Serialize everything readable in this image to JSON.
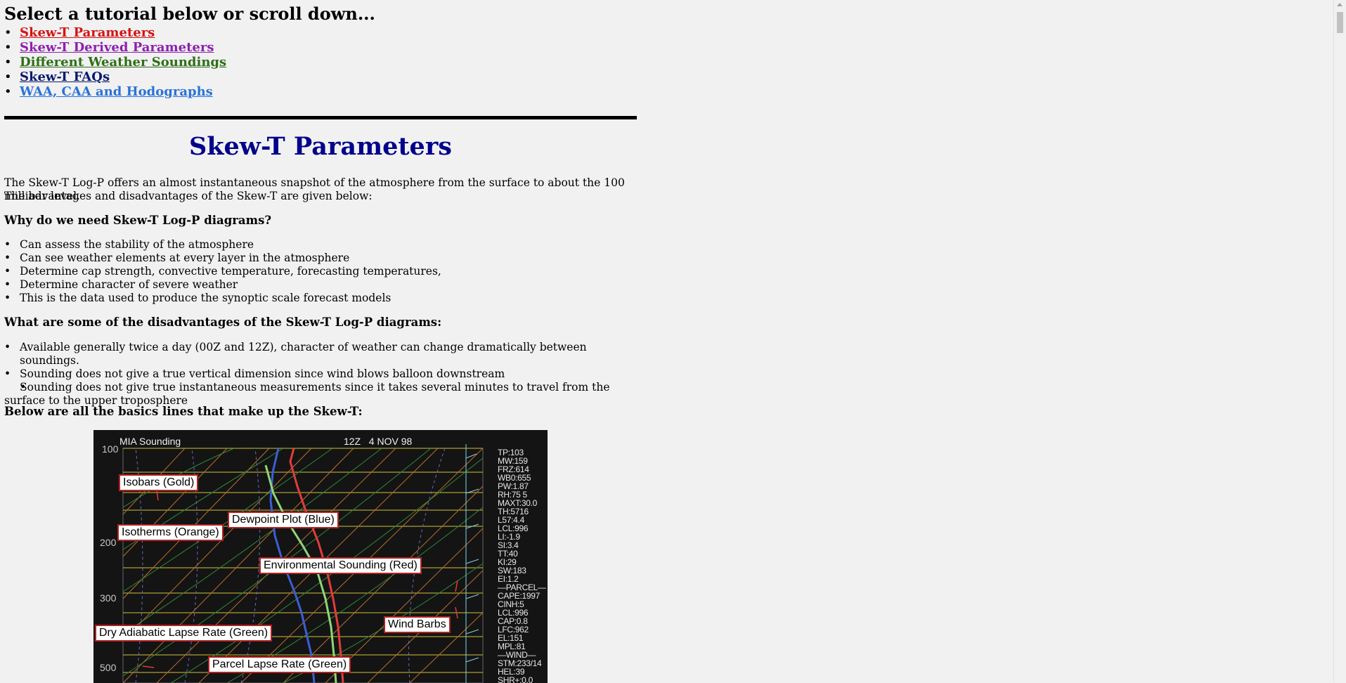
{
  "heading": "Select a tutorial below or scroll down...",
  "tutorials": [
    {
      "label": "Skew-T Parameters",
      "color": "#d41313"
    },
    {
      "label": "Skew-T Derived Parameters",
      "color": "#8e1fb0"
    },
    {
      "label": "Different Weather Soundings",
      "color": "#2e6e17"
    },
    {
      "label": "Skew-T FAQs",
      "color": "#0a1a6e"
    },
    {
      "label": "WAA, CAA and Hodographs",
      "color": "#2a73d6"
    }
  ],
  "section_title": "Skew-T Parameters",
  "intro_line1": "The Skew-T Log-P offers an almost instantaneous snapshot of the atmosphere from the surface to about the 100 millibar level.",
  "intro_line2": "The advantages and disadvantages of the Skew-T are given below:",
  "why_heading": "Why do we need Skew-T Log-P diagrams?",
  "why_items": [
    "Can assess the stability of the atmosphere",
    "Can see weather elements at every layer in the atmosphere",
    "Determine cap strength, convective temperature, forecasting temperatures,",
    "Determine character of severe weather",
    "This is the data used to produce the synoptic scale forecast models"
  ],
  "dis_heading": "What are some of the disadvantages of the Skew-T Log-P diagrams:",
  "dis_items": [
    "Available generally twice a day (00Z and 12Z), character of weather can change dramatically between soundings.",
    "Sounding does not give a true vertical dimension since wind blows balloon downstream",
    "Sounding does not give true instantaneous measurements since it takes several minutes to travel from the surface to the upper troposphere"
  ],
  "basics_heading": "Below are all the basics lines that make up the Skew-T:",
  "skewt": {
    "station": "MIA Sounding",
    "time": "12Z   4 NOV 98",
    "pressure_labels": [
      "100",
      "200",
      "300",
      "500"
    ],
    "callouts": {
      "isobars": "Isobars (Gold)",
      "isotherms": "Isotherms (Orange)",
      "dewpoint": "Dewpoint Plot (Blue)",
      "environment": "Environmental Sounding (Red)",
      "wind_barbs": "Wind Barbs",
      "dry_adiabat": "Dry Adiabatic Lapse Rate (Green)",
      "parcel": "Parcel Lapse Rate (Green)"
    },
    "stats": [
      "TP:103",
      "MW:159",
      "FRZ:614",
      "WB0:655",
      "PW:1.87",
      "RH:75 5",
      "MAXT:30.0",
      "TH:5716",
      "L57:4.4",
      "LCL:996",
      "LI:-1.9",
      "SI:3.4",
      "TT:40",
      "KI:29",
      "SW:183",
      "EI:1.2",
      "—PARCEL—",
      "CAPE:1997",
      "CINH:5",
      "LCL:996",
      "CAP:0.8",
      "LFC:962",
      "EL:151",
      "MPL:81",
      "—WIND—",
      "STM:233/14",
      "HEL:39",
      "SHR+:0.0"
    ]
  }
}
